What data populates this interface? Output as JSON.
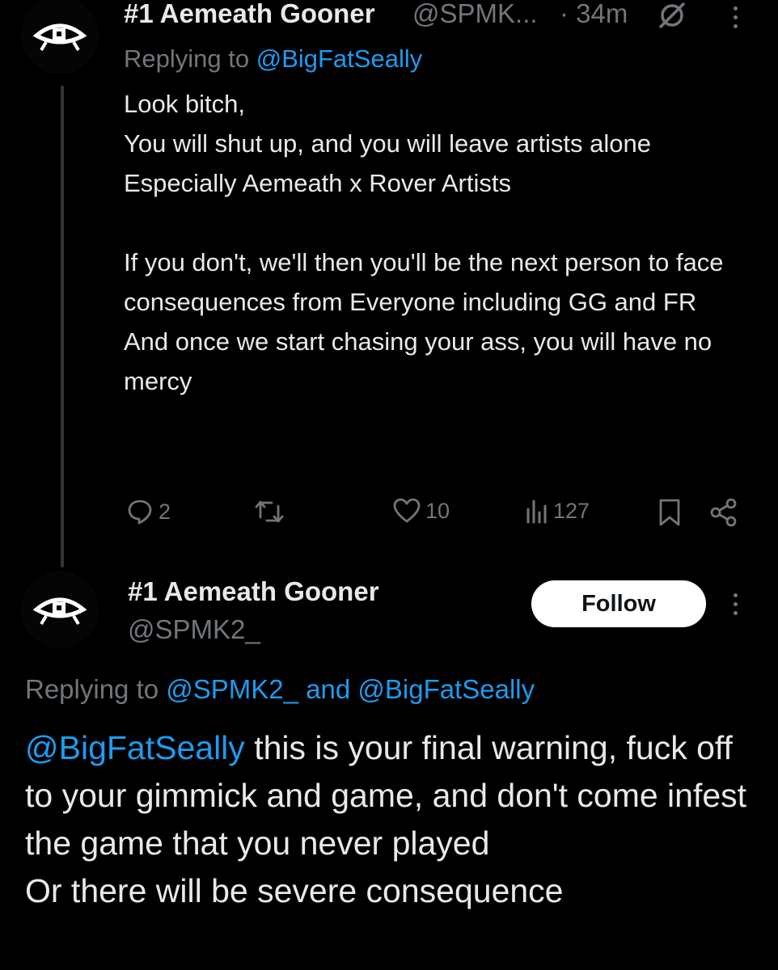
{
  "tweet1": {
    "display_name": "#1 Aemeath Gooner",
    "handle": "@SPMK...",
    "time": "· 34m",
    "replying_prefix": "Replying to ",
    "replying_to": "@BigFatSeally",
    "text": "Look bitch,\nYou will shut up, and you will leave artists alone\nEspecially Aemeath x Rover Artists\n\nIf you don't, we'll then you'll be the next person to face consequences from Everyone including GG and FR\nAnd once we start chasing your ass, you will have no mercy",
    "actions": {
      "replies": "2",
      "likes": "10",
      "views": "127"
    },
    "icons": [
      "reply-icon",
      "retweet-icon",
      "like-icon",
      "views-icon",
      "bookmark-icon",
      "share-icon",
      "grok-icon",
      "more-icon"
    ]
  },
  "tweet2": {
    "display_name": "#1 Aemeath Gooner",
    "handle": "@SPMK2_",
    "follow_label": "Follow",
    "replying_prefix": "Replying to ",
    "replying_to": "@SPMK2_ and @BigFatSeally",
    "mention": "@BigFatSeally",
    "text": " this is your final warning, fuck off to your gimmick and game, and don't come infest the game that you never played\nOr there will be severe consequence"
  },
  "colors": {
    "background": "#000000",
    "text": "#e7e9ea",
    "muted": "#71767b",
    "accent": "#1d9bf0"
  }
}
